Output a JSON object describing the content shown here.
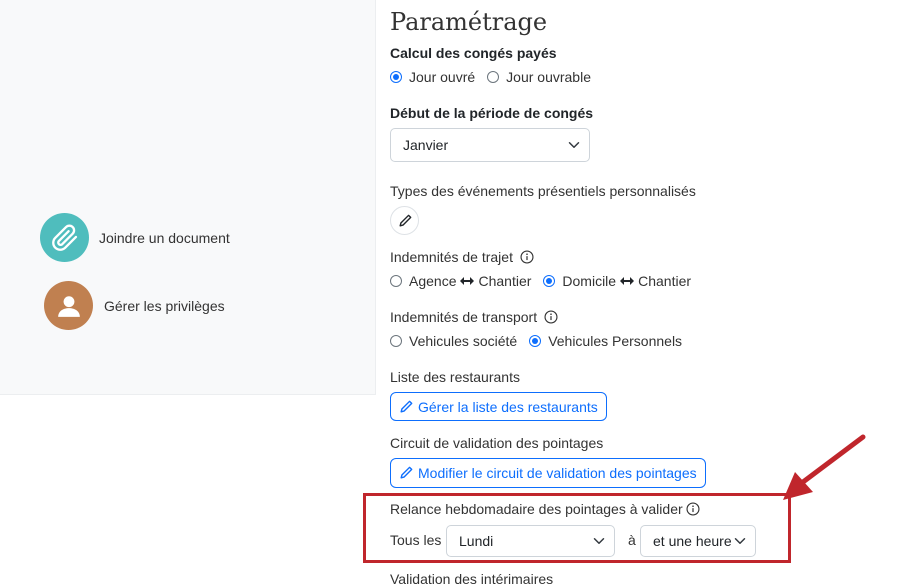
{
  "left_panel": {
    "actions": [
      {
        "label": "Joindre un document",
        "icon": "paperclip-icon",
        "color": "#4fbdbd"
      },
      {
        "label": "Gérer les privilèges",
        "icon": "user-icon",
        "color": "#c08050"
      }
    ]
  },
  "settings": {
    "title": "Paramétrage",
    "paid_leave": {
      "label": "Calcul des congés payés",
      "options": [
        "Jour ouvré",
        "Jour ouvrable"
      ],
      "selected": "Jour ouvré"
    },
    "leave_start": {
      "label": "Début de la période de congés",
      "value": "Janvier"
    },
    "event_types": {
      "label": "Types des événements présentiels personnalisés",
      "edit_icon": "pencil-icon"
    },
    "travel_allowance": {
      "label": "Indemnités de trajet",
      "option_1": {
        "from": "Agence",
        "to": "Chantier"
      },
      "option_2": {
        "from": "Domicile",
        "to": "Chantier"
      },
      "selected": "Domicile ↔ Chantier"
    },
    "transport_allowance": {
      "label": "Indemnités de transport",
      "options": [
        "Vehicules société",
        "Vehicules Personnels"
      ],
      "selected": "Vehicules Personnels"
    },
    "restaurants": {
      "label": "Liste des restaurants",
      "button": "Gérer la liste des restaurants"
    },
    "validation_circuit": {
      "label": "Circuit de validation des pointages",
      "button": "Modifier le circuit de validation des pointages"
    },
    "weekly_reminder": {
      "label": "Relance hebdomadaire des pointages à valider",
      "prefix": "Tous les",
      "day": "Lundi",
      "at": "à",
      "time": "et une heure"
    },
    "temp_workers": {
      "label": "Validation des intérimaires"
    }
  },
  "colors": {
    "accent": "#0d6efd",
    "highlight": "#c0262c"
  }
}
